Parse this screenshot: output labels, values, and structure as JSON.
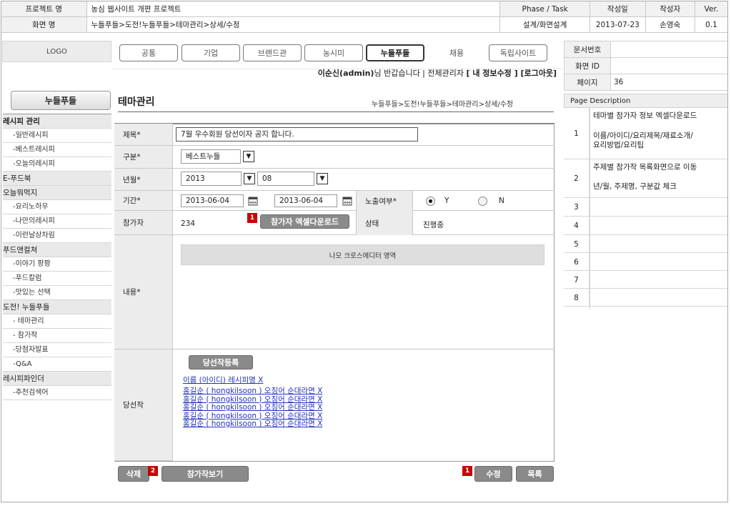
{
  "header": {
    "project_label": "프로젝트 명",
    "project_value": "농심 웹사이트 개편 프로젝트",
    "phase_label": "Phase / Task",
    "date_label": "작성일",
    "author_label": "작성자",
    "version_label": "Ver.",
    "screen_label": "화면 명",
    "screen_value": "누들푸들>도전!누들푸들>테마관리>상세/수정",
    "phase_value": "설계/화면설계",
    "date_value": "2013-07-23",
    "author_value": "손영숙",
    "version_value": "0.1"
  },
  "meta": {
    "doc_no_label": "문서번호",
    "doc_no_value": "",
    "screen_id_label": "화면 ID",
    "screen_id_value": "",
    "page_label": "페이지",
    "page_value": "36"
  },
  "logo": "LOGO",
  "nav": [
    "공통",
    "기업",
    "브랜드관",
    "농시미",
    "누들푸들",
    "채용",
    "독립사이트"
  ],
  "welcome": {
    "user": "이순신(admin)",
    "text": "님 반갑습니다 | 전체관리자",
    "links": "[ 내 정보수정 ] [로그아웃]"
  },
  "sidebar": {
    "title": "누들푸들",
    "items": [
      {
        "label": "레시피 관리",
        "type": "cat"
      },
      {
        "label": "-일반레시피",
        "type": "sub"
      },
      {
        "label": "-베스트레시피",
        "type": "sub"
      },
      {
        "label": "-오늘의레시피",
        "type": "sub"
      },
      {
        "label": "E-푸드북",
        "type": "cat"
      },
      {
        "label": "오늘뭐먹지",
        "type": "cat"
      },
      {
        "label": "-요리노하우",
        "type": "sub"
      },
      {
        "label": "-나만의레시피",
        "type": "sub"
      },
      {
        "label": "-이런날상차림",
        "type": "sub"
      },
      {
        "label": "푸드앤컬쳐",
        "type": "cat"
      },
      {
        "label": "-이야기 팡팡",
        "type": "sub"
      },
      {
        "label": "-푸드칼럼",
        "type": "sub"
      },
      {
        "label": "-맛있는 선택",
        "type": "sub"
      },
      {
        "label": "도전! 누들푸들",
        "type": "cat"
      },
      {
        "label": "- 테마관리",
        "type": "sub"
      },
      {
        "label": "- 참가작",
        "type": "sub"
      },
      {
        "label": "-당첨자발표",
        "type": "sub"
      },
      {
        "label": "-Q&A",
        "type": "sub"
      },
      {
        "label": "레시피파인더",
        "type": "cat"
      },
      {
        "label": "-추천검색어",
        "type": "sub"
      }
    ]
  },
  "content": {
    "title": "테마관리",
    "breadcrumb": "누들푸들>도전!누들푸들>테마관리>상세/수정"
  },
  "form": {
    "title_label": "제목*",
    "title_value": "7월 우수회원 당선이자 공지 합니다.",
    "category_label": "구분*",
    "category_value": "베스트누들",
    "yearmonth_label": "년월*",
    "year_value": "2013",
    "month_value": "08",
    "period_label": "기간*",
    "start_date": "2013-06-04",
    "end_date": "2013-06-04",
    "exposure_label": "노출여부*",
    "exposure_yes": "Y",
    "exposure_no": "N",
    "exposure_selected": "Y",
    "participants_label": "참가자",
    "participants_value": "234",
    "excel_button": "참가자 엑셀다운로드",
    "excel_badge": "1",
    "status_label": "상태",
    "status_value": "진행중",
    "content_label": "내용*",
    "editor_placeholder": "나모 크로스에디터 영역",
    "winners_label": "당선작",
    "register_winner_button": "당선작등록",
    "winners_header": "이름 (아이디) 레시피명 X",
    "winners": [
      "홍길순 ( hongkilsoon ) 오징어 순대라면 X",
      "홍길순 ( hongkilsoon ) 오징어 순대라면 X",
      "홍길순 ( hongkilsoon ) 오징어 순대라면 X",
      "홍길순 ( hongkilsoon ) 오징어 순대라면 X",
      "홍길순 ( hongkilsoon ) 오징어 순대라면 X"
    ]
  },
  "actions": {
    "delete": "삭제",
    "delete_badge": "2",
    "view_entries": "참가작보기",
    "edit_badge": "1",
    "edit": "수정",
    "list": "목록"
  },
  "page_description": {
    "title": "Page Description",
    "rows": [
      {
        "num": "1",
        "lines": [
          "테마별 참가자 정보 엑셀다운로드",
          "이름/아이디/요리제목/재료소개/",
          "요리방법/요리팁"
        ]
      },
      {
        "num": "2",
        "lines": [
          "주제별 참가작 목록화면으로 이동",
          "년/월, 주제명, 구분값 체크"
        ]
      },
      {
        "num": "3",
        "lines": []
      },
      {
        "num": "4",
        "lines": []
      },
      {
        "num": "5",
        "lines": []
      },
      {
        "num": "6",
        "lines": []
      },
      {
        "num": "7",
        "lines": []
      },
      {
        "num": "8",
        "lines": []
      }
    ]
  },
  "colors": {
    "badge": "#cc0000",
    "link": "#2233bb",
    "button": "#8a8a8a"
  }
}
